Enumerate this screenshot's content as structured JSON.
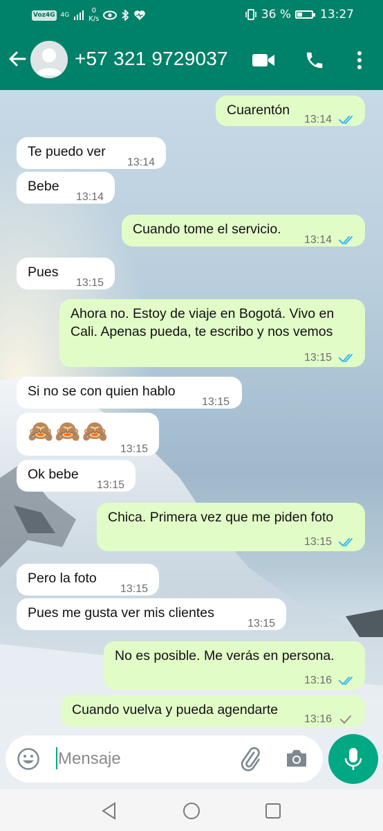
{
  "status_bar": {
    "carrier_badge": "Voz4G",
    "network": "4G",
    "speed_value": "0",
    "speed_unit": "K/s",
    "battery": "36 %",
    "battery_level": 0.36,
    "time": "13:27"
  },
  "header": {
    "contact": "+57 321 9729037"
  },
  "messages": [
    {
      "dir": "out",
      "text": "Cuarentón",
      "time": "13:14",
      "status": "read"
    },
    {
      "dir": "in",
      "text": "Te puedo ver",
      "time": "13:14"
    },
    {
      "dir": "in",
      "text": "Bebe",
      "time": "13:14"
    },
    {
      "dir": "out",
      "text": "Cuando tome el servicio.",
      "time": "13:14",
      "status": "read"
    },
    {
      "dir": "in",
      "text": "Pues",
      "time": "13:15"
    },
    {
      "dir": "out",
      "text": "Ahora no. Estoy de viaje en Bogotá. Vivo en Cali. Apenas pueda, te escribo y nos vemos",
      "time": "13:15",
      "status": "read"
    },
    {
      "dir": "in",
      "text": "Si no se con quien hablo",
      "time": "13:15"
    },
    {
      "dir": "in",
      "text": "🙈🙈🙈",
      "time": "13:15"
    },
    {
      "dir": "in",
      "text": "Ok bebe",
      "time": "13:15"
    },
    {
      "dir": "out",
      "text": "Chica. Primera vez que me piden foto",
      "time": "13:15",
      "status": "read"
    },
    {
      "dir": "in",
      "text": "Pero la foto",
      "time": "13:15"
    },
    {
      "dir": "in",
      "text": "Pues me gusta ver mis clientes",
      "time": "13:15"
    },
    {
      "dir": "out",
      "text": "No es posible. Me verás en persona.",
      "time": "13:16",
      "status": "read"
    },
    {
      "dir": "out",
      "text": "Cuando vuelva y pueda agendarte",
      "time": "13:16",
      "status": "sent"
    }
  ],
  "composer": {
    "placeholder": "Mensaje"
  },
  "colors": {
    "header": "#008169",
    "outgoing_bubble": "#e2fcc8",
    "incoming_bubble": "#ffffff",
    "read_ticks": "#34b7f1",
    "mic_button": "#00a884"
  },
  "icons": [
    "back-arrow-icon",
    "avatar-placeholder-icon",
    "video-call-icon",
    "phone-icon",
    "more-vert-icon",
    "emoji-icon",
    "attach-icon",
    "camera-icon",
    "mic-icon",
    "nav-back-icon",
    "nav-home-icon",
    "nav-recents-icon"
  ]
}
